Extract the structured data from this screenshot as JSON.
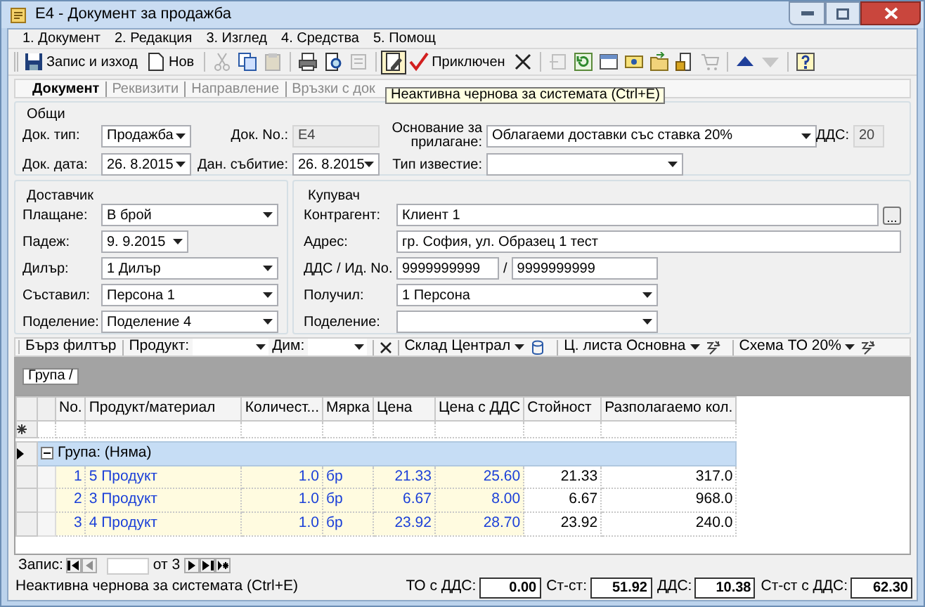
{
  "window": {
    "title": "E4 - Документ за продажба"
  },
  "menu": [
    "1. Документ",
    "2. Редакция",
    "3. Изглед",
    "4. Средства",
    "5. Помощ"
  ],
  "toolbar": [
    [
      {
        "kind": "save",
        "label": "Запис и изход",
        "disabled": false,
        "hovered": false
      },
      {
        "kind": "new",
        "label": "Нов",
        "disabled": false,
        "hovered": false
      }
    ],
    [
      {
        "kind": "cut",
        "disabled": true,
        "hovered": false
      },
      {
        "kind": "copy",
        "disabled": false,
        "hovered": false
      },
      {
        "kind": "paste",
        "disabled": true,
        "hovered": false
      }
    ],
    [
      {
        "kind": "print",
        "disabled": false,
        "hovered": false
      },
      {
        "kind": "preview",
        "disabled": false,
        "hovered": false
      },
      {
        "kind": "page",
        "disabled": true,
        "hovered": false
      }
    ],
    [
      {
        "kind": "draft",
        "disabled": false,
        "hovered": true
      },
      {
        "kind": "check",
        "label": "Приключен",
        "disabled": false,
        "hovered": false
      },
      {
        "kind": "cross",
        "disabled": false,
        "hovered": false
      }
    ],
    [
      {
        "kind": "undo",
        "disabled": true,
        "hovered": false
      },
      {
        "kind": "refresh",
        "disabled": false,
        "hovered": false
      },
      {
        "kind": "window",
        "disabled": false,
        "hovered": false
      },
      {
        "kind": "card",
        "disabled": false,
        "hovered": false
      },
      {
        "kind": "folder",
        "disabled": false,
        "hovered": false
      },
      {
        "kind": "lock",
        "disabled": false,
        "hovered": false
      },
      {
        "kind": "cart",
        "disabled": true,
        "hovered": false
      }
    ],
    [
      {
        "kind": "up",
        "disabled": false,
        "hovered": false
      },
      {
        "kind": "down",
        "disabled": true,
        "hovered": false
      }
    ],
    [
      {
        "kind": "help",
        "disabled": false,
        "hovered": false
      }
    ]
  ],
  "tooltip": "Неактивна чернова за системата (Ctrl+E)",
  "tabs": [
    {
      "label": "Документ",
      "selected": true
    },
    {
      "label": "Реквизити",
      "selected": false
    },
    {
      "label": "Направление",
      "selected": false
    },
    {
      "label": "Връзки с док",
      "selected": false
    }
  ],
  "general": {
    "title": "Общи",
    "fields": [
      {
        "label": "Док. тип:",
        "kind": "combo",
        "value": "Продажба"
      },
      {
        "label": "Док. No.:",
        "kind": "readonly",
        "value": "E4"
      },
      {
        "label": "Основание за прилагане:",
        "kind": "combo",
        "value": "Облагаеми доставки със ставка 20%"
      },
      {
        "label": "ДДС:",
        "kind": "readonly",
        "value": "20"
      },
      {
        "label": "Док. дата:",
        "kind": "combo",
        "value": "26. 8.2015"
      },
      {
        "label": "Дан. събитие:",
        "kind": "combo",
        "value": "26. 8.2015"
      },
      {
        "label": "Тип известие:",
        "kind": "combo"
      }
    ]
  },
  "supplier": {
    "title": "Доставчик",
    "fields": [
      {
        "label": "Плащане:",
        "kind": "combo",
        "value": "В брой"
      },
      {
        "label": "Падеж:",
        "kind": "combo",
        "value": "9. 9.2015"
      },
      {
        "label": "Дилър:",
        "kind": "combo",
        "value": "1 Дилър"
      },
      {
        "label": "Съставил:",
        "kind": "combo",
        "value": "Персона 1"
      },
      {
        "label": "Поделение:",
        "kind": "combo",
        "value": "Поделение 4"
      }
    ]
  },
  "buyer": {
    "title": "Купувач",
    "fields": [
      {
        "label": "Контрагент:",
        "kind": "lookup",
        "value": "Клиент 1",
        "button": "..."
      },
      {
        "label": "Адрес:",
        "kind": "text",
        "value": "гр. София, ул. Образец 1 тест"
      },
      {
        "label": "ДДС / Ид. No.",
        "kind": "pair",
        "values": [
          "9999999999",
          "9999999999"
        ],
        "separator": "/"
      },
      {
        "label": "Получил:",
        "kind": "combo",
        "value": "1 Персона"
      },
      {
        "label": "Поделение:",
        "kind": "combo"
      }
    ]
  },
  "quick_filter": {
    "title": "Бърз филтър",
    "product_label": "Продукт:",
    "dim_label": "Дим:",
    "warehouse_label": "Склад",
    "warehouse": "Централ",
    "price_list_label": "Ц. листа",
    "price_list": "Основна",
    "scheme_label": "Схема",
    "scheme": "ТО 20%"
  },
  "group_by": [
    "Група /"
  ],
  "table": {
    "columns": [
      {
        "label": "No.",
        "editable": true
      },
      {
        "label": "Продукт/материал",
        "editable": true
      },
      {
        "label": "Количест...",
        "editable": true
      },
      {
        "label": "Мярка",
        "editable": true
      },
      {
        "label": "Цена",
        "editable": true
      },
      {
        "label": "Цена с ДДС",
        "editable": true
      },
      {
        "label": "Стойност",
        "editable": false
      },
      {
        "label": "Разполагаемо кол.",
        "editable": false
      }
    ],
    "group": {
      "label": "Група: (Няма)",
      "expanded": true
    },
    "rows": [
      [
        "1",
        "5 Продукт",
        "1.0",
        "бр",
        "21.33",
        "25.60",
        "21.33",
        "317.0"
      ],
      [
        "2",
        "3 Продукт",
        "1.0",
        "бр",
        "6.67",
        "8.00",
        "6.67",
        "968.0"
      ],
      [
        "3",
        "4 Продукт",
        "1.0",
        "бр",
        "23.92",
        "28.70",
        "23.92",
        "240.0"
      ]
    ]
  },
  "record_nav": {
    "label": "Запис:",
    "of": "от 3"
  },
  "status_bar": {
    "text": "Неактивна чернова за системата (Ctrl+E)",
    "totals": [
      {
        "label": "ТО с ДДС:",
        "value": "0.00"
      },
      {
        "label": "Ст-ст:",
        "value": "51.92"
      },
      {
        "label": "ДДС:",
        "value": "10.38"
      },
      {
        "label": "Ст-ст с ДДС:",
        "value": "62.30"
      }
    ]
  }
}
